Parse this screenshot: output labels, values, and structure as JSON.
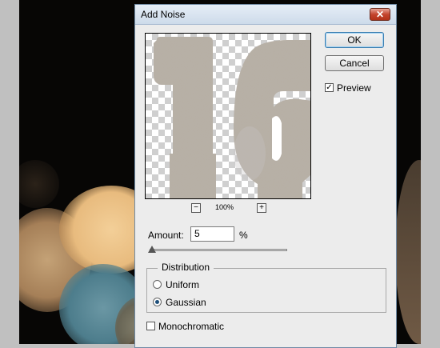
{
  "dialog": {
    "title": "Add Noise",
    "close_icon": "close-icon",
    "ok_label": "OK",
    "cancel_label": "Cancel",
    "preview_label": "Preview",
    "preview_checked": true,
    "zoom_level": "100%",
    "zoom_out_icon": "minus-icon",
    "zoom_in_icon": "plus-icon",
    "amount_label": "Amount:",
    "amount_value": "5",
    "amount_unit": "%",
    "distribution_title": "Distribution",
    "distribution_options": [
      "Uniform",
      "Gaussian"
    ],
    "distribution_selected": "Gaussian",
    "monochromatic_label": "Monochromatic",
    "monochromatic_checked": false
  },
  "colors": {
    "titlebar": "#cddbea",
    "close_button": "#c4442e",
    "dialog_bg": "#ececec",
    "canvas_bg": "#070605"
  }
}
